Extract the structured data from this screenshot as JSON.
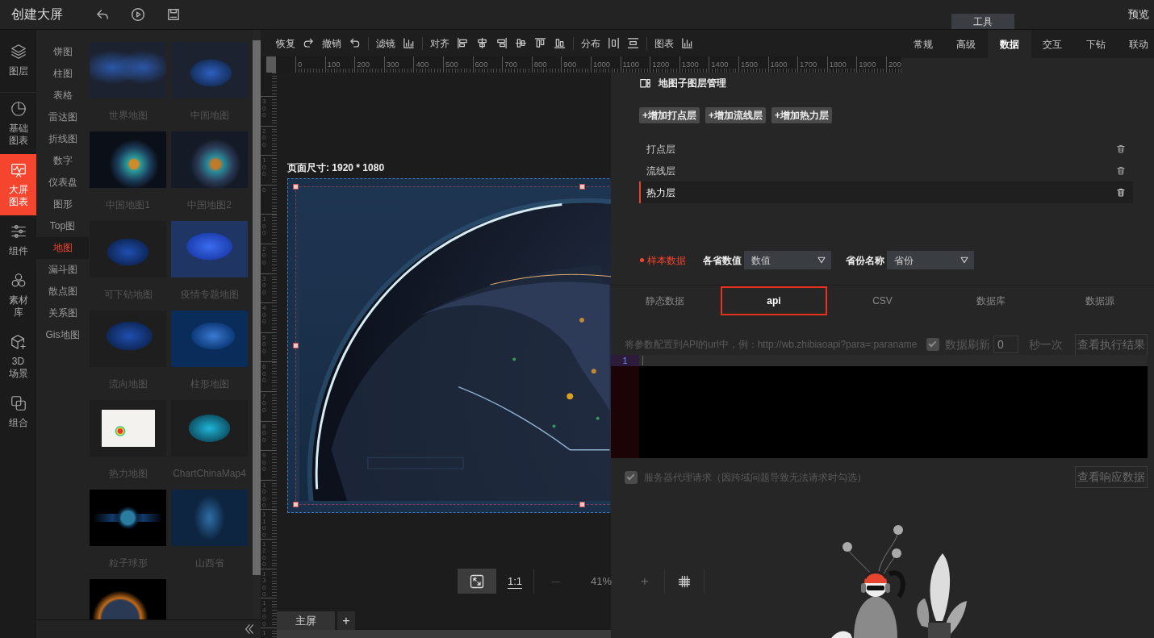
{
  "top_bar": {
    "title": "创建大屏",
    "tool_tab": "工具",
    "preview": "预览"
  },
  "nav": [
    {
      "label": "图层",
      "selected": false
    },
    {
      "label": "基础图表",
      "selected": false
    },
    {
      "label": "大屏图表",
      "selected": true
    },
    {
      "label": "组件",
      "selected": false
    },
    {
      "label": "素材库",
      "selected": false
    },
    {
      "label": "3D场景",
      "selected": false
    },
    {
      "label": "组合",
      "selected": false
    }
  ],
  "categories": [
    {
      "label": "饼图",
      "selected": false
    },
    {
      "label": "柱图",
      "selected": false
    },
    {
      "label": "表格",
      "selected": false
    },
    {
      "label": "雷达图",
      "selected": false
    },
    {
      "label": "折线图",
      "selected": false
    },
    {
      "label": "数字",
      "selected": false
    },
    {
      "label": "仪表盘",
      "selected": false
    },
    {
      "label": "图形",
      "selected": false
    },
    {
      "label": "Top图",
      "selected": false
    },
    {
      "label": "地图",
      "selected": true
    },
    {
      "label": "漏斗图",
      "selected": false
    },
    {
      "label": "散点图",
      "selected": false
    },
    {
      "label": "关系图",
      "selected": false
    },
    {
      "label": "Gis地图",
      "selected": false
    }
  ],
  "gallery": [
    {
      "kind": "captioned",
      "caption": "世界地图"
    },
    {
      "kind": "captioned",
      "caption": "中国地图"
    },
    {
      "kind": "captioned",
      "caption": "中国地图1"
    },
    {
      "kind": "captioned",
      "caption": "中国地图2"
    },
    {
      "kind": "captioned",
      "caption": "可下钻地图"
    },
    {
      "kind": "captioned",
      "caption": "疫情专题地图"
    },
    {
      "kind": "captioned",
      "caption": "流向地图"
    },
    {
      "kind": "captioned",
      "caption": "柱形地图"
    },
    {
      "kind": "captioned",
      "caption": "热力地图"
    },
    {
      "kind": "captioned",
      "caption": "ChartChinaMap4"
    },
    {
      "kind": "captioned",
      "caption": "粒子球形"
    },
    {
      "kind": "captioned",
      "caption": "山西省"
    },
    {
      "kind": "image"
    }
  ],
  "toolbar": [
    {
      "label": "恢复"
    },
    {
      "label": "撤销"
    },
    {
      "label": "滤镜"
    },
    {
      "label": "对齐"
    },
    {
      "label": "分布"
    },
    {
      "label": "图表"
    }
  ],
  "rulers": {
    "horizontal": [
      "0",
      "100",
      "200",
      "300",
      "400",
      "500",
      "600",
      "700",
      "800",
      "900",
      "1000",
      "1100",
      "1200",
      "1300",
      "1400",
      "1500",
      "1600",
      "1700",
      "1800",
      "1900",
      "200"
    ],
    "vertical": [
      "300",
      "200",
      "100",
      "0",
      "100",
      "200",
      "300",
      "400",
      "500",
      "600",
      "700",
      "800",
      "900",
      "1000",
      "1100",
      "1200",
      "1300",
      "1400",
      "1"
    ]
  },
  "canvas": {
    "size_label": "页面尺寸: 1920 * 1080"
  },
  "zoom": {
    "actual_size": "1:1",
    "zoom_out": "—",
    "value": "41%",
    "zoom_in": "+"
  },
  "screens": [
    {
      "label": "主屏",
      "selected": true
    }
  ],
  "add_screen": "+",
  "property_tabs": [
    {
      "label": "常规",
      "selected": false
    },
    {
      "label": "高级",
      "selected": false
    },
    {
      "label": "数据",
      "selected": true
    },
    {
      "label": "交互",
      "selected": false
    },
    {
      "label": "下钻",
      "selected": false
    },
    {
      "label": "联动",
      "selected": false
    }
  ],
  "sublayers": {
    "title": "地图子图层管理",
    "add_buttons": [
      "+增加打点层",
      "+增加流线层",
      "+增加热力层"
    ],
    "items": [
      {
        "label": "打点层",
        "selected": false
      },
      {
        "label": "流线层",
        "selected": false
      },
      {
        "label": "热力层",
        "selected": true
      }
    ]
  },
  "mapping": {
    "sample_label": "样本数据",
    "fields": [
      {
        "label": "各省数值",
        "value": "数值"
      },
      {
        "label": "省份名称",
        "value": "省份"
      }
    ]
  },
  "source_tabs": [
    {
      "label": "静态数据",
      "selected": false
    },
    {
      "label": "api",
      "selected": true
    },
    {
      "label": "CSV",
      "selected": false
    },
    {
      "label": "数据库",
      "selected": false
    },
    {
      "label": "数据源",
      "selected": false
    }
  ],
  "api": {
    "hint": "将参数配置到API的url中，例：http://wb.zhibiaoapi?para=:paraname",
    "refresh": {
      "checked": true,
      "label": "数据刷新",
      "value": "0",
      "unit": "秒一次"
    },
    "run_button": "查看执行结果",
    "editor": {
      "line_numbers": [
        "1"
      ]
    },
    "proxy": {
      "checked": true,
      "label": "服务器代理请求（因跨域问题导致无法请求时勾选）"
    },
    "response_button": "查看响应数据"
  }
}
